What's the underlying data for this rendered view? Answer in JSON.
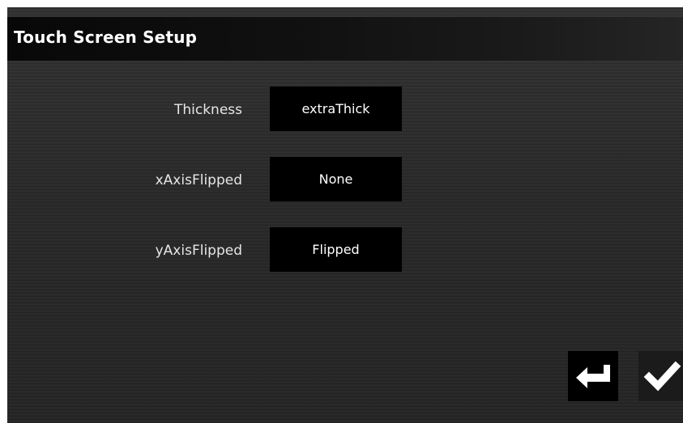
{
  "window": {
    "title": "Touch Screen Setup"
  },
  "settings": [
    {
      "label": "Thickness",
      "value": "extraThick"
    },
    {
      "label": "xAxisFlipped",
      "value": "None"
    },
    {
      "label": "yAxisFlipped",
      "value": "Flipped"
    }
  ],
  "footer": {
    "back_icon": "return-arrow-icon",
    "confirm_icon": "checkmark-icon"
  },
  "colors": {
    "background": "#2b2b2b",
    "title_bar": "#0a0a0a",
    "button": "#000000",
    "text": "#ffffff"
  }
}
